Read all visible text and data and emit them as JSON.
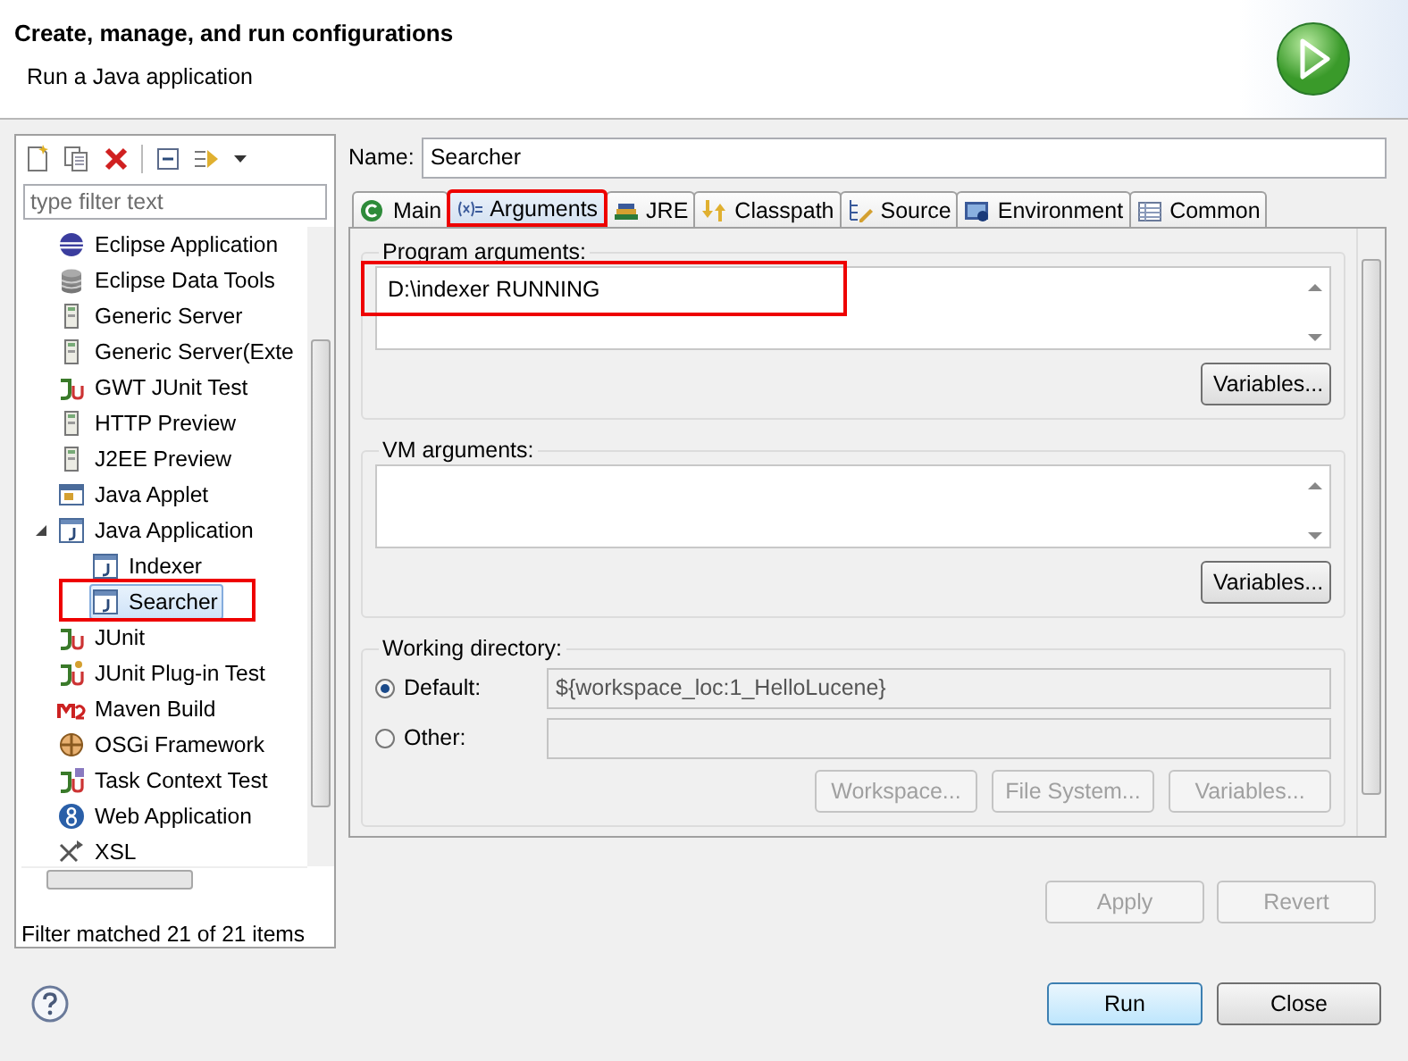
{
  "header": {
    "title": "Create, manage, and run configurations",
    "subtitle": "Run a Java application"
  },
  "filter": {
    "placeholder": "type filter text"
  },
  "tree": [
    {
      "label": "Eclipse Application",
      "kind": "eclipse",
      "selected": false
    },
    {
      "label": "Eclipse Data Tools",
      "kind": "database",
      "selected": false
    },
    {
      "label": "Generic Server",
      "kind": "server",
      "selected": false
    },
    {
      "label": "Generic Server(Exte",
      "kind": "server",
      "selected": false
    },
    {
      "label": "GWT JUnit Test",
      "kind": "junit",
      "selected": false
    },
    {
      "label": "HTTP Preview",
      "kind": "server",
      "selected": false
    },
    {
      "label": "J2EE Preview",
      "kind": "server",
      "selected": false
    },
    {
      "label": "Java Applet",
      "kind": "applet",
      "selected": false
    },
    {
      "label": "Java Application",
      "kind": "java",
      "selected": false,
      "expanded": true,
      "children": [
        {
          "label": "Indexer",
          "kind": "java",
          "selected": false
        },
        {
          "label": "Searcher",
          "kind": "java",
          "selected": true,
          "annotated": true
        }
      ]
    },
    {
      "label": "JUnit",
      "kind": "junit",
      "selected": false
    },
    {
      "label": "JUnit Plug-in Test",
      "kind": "junit-plugin",
      "selected": false
    },
    {
      "label": "Maven Build",
      "kind": "maven",
      "selected": false
    },
    {
      "label": "OSGi Framework",
      "kind": "osgi",
      "selected": false
    },
    {
      "label": "Task Context Test",
      "kind": "task",
      "selected": false
    },
    {
      "label": "Web Application",
      "kind": "web",
      "selected": false
    },
    {
      "label": "XSL",
      "kind": "xsl",
      "selected": false
    }
  ],
  "filter_status": "Filter matched 21 of 21 items",
  "name_field": {
    "label": "Name:",
    "value": "Searcher"
  },
  "tabs": [
    {
      "label": "Main",
      "kind": "main",
      "selected": false
    },
    {
      "label": "Arguments",
      "kind": "arguments",
      "selected": true,
      "annotated": true
    },
    {
      "label": "JRE",
      "kind": "jre",
      "selected": false
    },
    {
      "label": "Classpath",
      "kind": "classpath",
      "selected": false
    },
    {
      "label": "Source",
      "kind": "source",
      "selected": false
    },
    {
      "label": "Environment",
      "kind": "environment",
      "selected": false
    },
    {
      "label": "Common",
      "kind": "common",
      "selected": false
    }
  ],
  "program_arguments": {
    "label": "Program arguments:",
    "value": "D:\\indexer RUNNING",
    "annotated": true,
    "button": "Variables..."
  },
  "vm_arguments": {
    "label": "VM arguments:",
    "button": "Variables..."
  },
  "working_directory": {
    "label": "Working directory:",
    "options": [
      {
        "label": "Default:",
        "selected": true,
        "field": {
          "value": "${workspace_loc:1_HelloLucene}",
          "disabled": true
        }
      },
      {
        "label": "Other:",
        "selected": false,
        "field": {
          "disabled": true
        }
      }
    ],
    "buttons": [
      {
        "label": "Workspace...",
        "disabled": true
      },
      {
        "label": "File System...",
        "disabled": true
      },
      {
        "label": "Variables...",
        "disabled": true
      }
    ]
  },
  "actions": [
    {
      "label": "Apply",
      "disabled": true
    },
    {
      "label": "Revert",
      "disabled": true
    }
  ],
  "footer_buttons": [
    {
      "label": "Run",
      "default": true
    },
    {
      "label": "Close",
      "default": false
    }
  ]
}
